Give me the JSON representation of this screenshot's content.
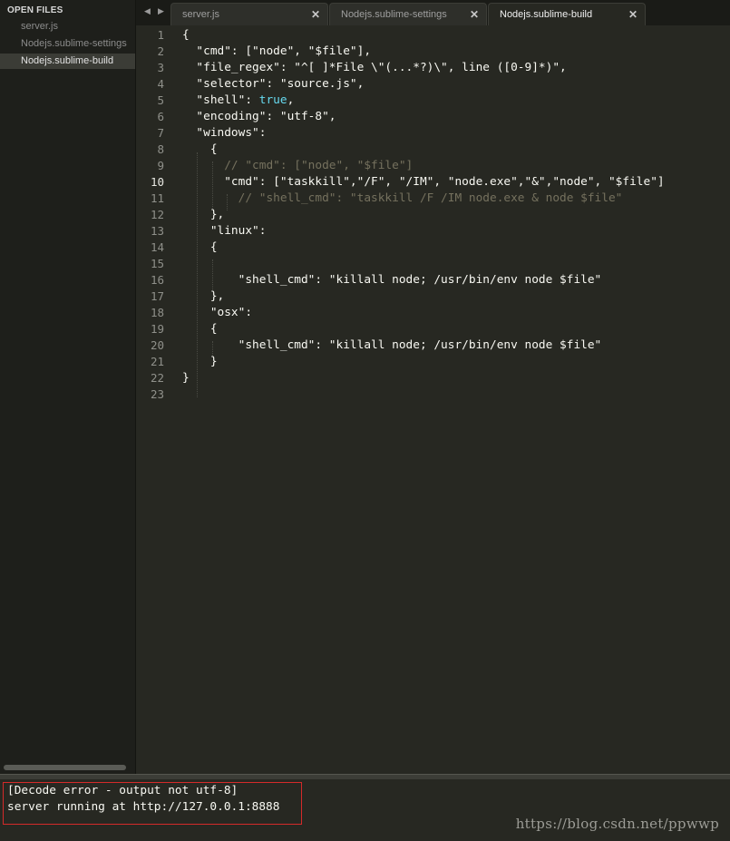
{
  "sidebar": {
    "header": "OPEN FILES",
    "files": [
      "server.js",
      "Nodejs.sublime-settings",
      "Nodejs.sublime-build"
    ],
    "active_index": 2
  },
  "tabs": {
    "nav_left": "◀",
    "nav_right": "▶",
    "items": [
      {
        "label": "server.js",
        "close": "✕"
      },
      {
        "label": "Nodejs.sublime-settings",
        "close": "✕"
      },
      {
        "label": "Nodejs.sublime-build",
        "close": "✕"
      }
    ],
    "active_index": 2
  },
  "editor": {
    "current_line": 10,
    "lines": [
      "{",
      "  \"cmd\": [\"node\", \"$file\"],",
      "  \"file_regex\": \"^[ ]*File \\\"(...*?)\\\", line ([0-9]*)\",",
      "  \"selector\": \"source.js\",",
      "  \"shell\": true,",
      "  \"encoding\": \"utf-8\",",
      "  \"windows\":",
      "    {",
      "      // \"cmd\": [\"node\", \"$file\"]",
      "      \"cmd\": [\"taskkill\",\"/F\", \"/IM\", \"node.exe\",\"&\",\"node\", \"$file\"]",
      "        // \"shell_cmd\": \"taskkill /F /IM node.exe & node $file\"",
      "    },",
      "    \"linux\":",
      "    {",
      "",
      "        \"shell_cmd\": \"killall node; /usr/bin/env node $file\"",
      "    },",
      "    \"osx\":",
      "    {",
      "        \"shell_cmd\": \"killall node; /usr/bin/env node $file\"",
      "    }",
      "}",
      ""
    ],
    "comment_lines": [
      9,
      11
    ]
  },
  "output": {
    "lines": [
      "[Decode error - output not utf-8]",
      "server running at http://127.0.0.1:8888"
    ]
  },
  "watermark": "https://blog.csdn.net/ppwwp",
  "colors": {
    "background": "#272822",
    "text": "#f8f8f2",
    "comment": "#75715e",
    "keyword": "#66d9ef",
    "highlight_box": "#d42a2a"
  }
}
